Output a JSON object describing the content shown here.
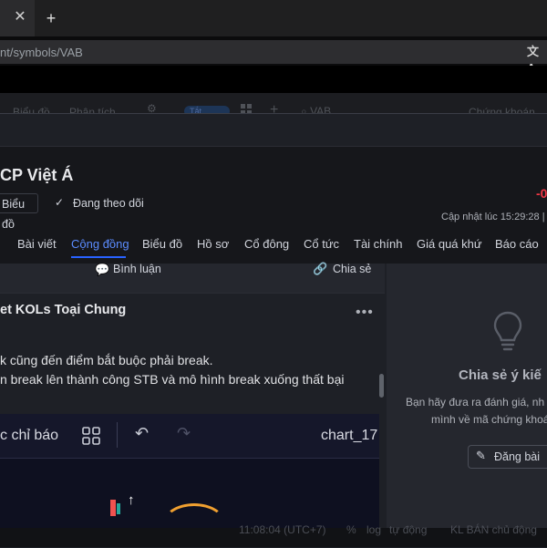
{
  "browser": {
    "tab_close": "✕",
    "new_tab": "+",
    "url": "nt/symbols/VAB",
    "translate_glyph": "文A"
  },
  "app_toolbar": {
    "item_a": "Biểu đồ",
    "item_b": "Phân tích",
    "toggle": "Tắt",
    "search_text": "VAB",
    "right_label": "Chứng khoán"
  },
  "header": {
    "company": "CP Việt Á",
    "chart_button": "Biểu đồ",
    "following": "Đang theo dõi",
    "price_change": "-0",
    "updated": "Cập nhật lúc  15:29:28 |"
  },
  "tabs": [
    "Bài viết",
    "Cộng đồng",
    "Biểu đồ",
    "Hồ sơ",
    "Cổ đông",
    "Cổ tức",
    "Tài chính",
    "Giá quá khứ",
    "Báo cáo"
  ],
  "active_tab": "Cộng đồng",
  "post": {
    "comment": "Bình luận",
    "share": "Chia sẻ",
    "author": "et KOLs Toại Chung",
    "more": "•••",
    "line1": "k cũng đến điểm bắt buộc phải break.",
    "line2": "n break lên thành công STB và mô hình break xuống thất bại"
  },
  "chart_image": {
    "indicators": "c chỉ báo",
    "chart_name": "chart_17"
  },
  "side_panel": {
    "title": "Chia sẻ ý kiế",
    "desc1": "Bạn hãy đưa ra đánh giá, nh",
    "desc2": "mình về mã chứng khoá",
    "post_button": "Đăng bài"
  },
  "status": {
    "time": "11:08:04 (UTC+7)",
    "pct": "%",
    "log": "log",
    "auto": "tự động",
    "kl": "KL BÁN chủ động"
  },
  "colors": {
    "accent": "#2962ff",
    "negative": "#f23645",
    "modal_bg": "#1e2026"
  }
}
